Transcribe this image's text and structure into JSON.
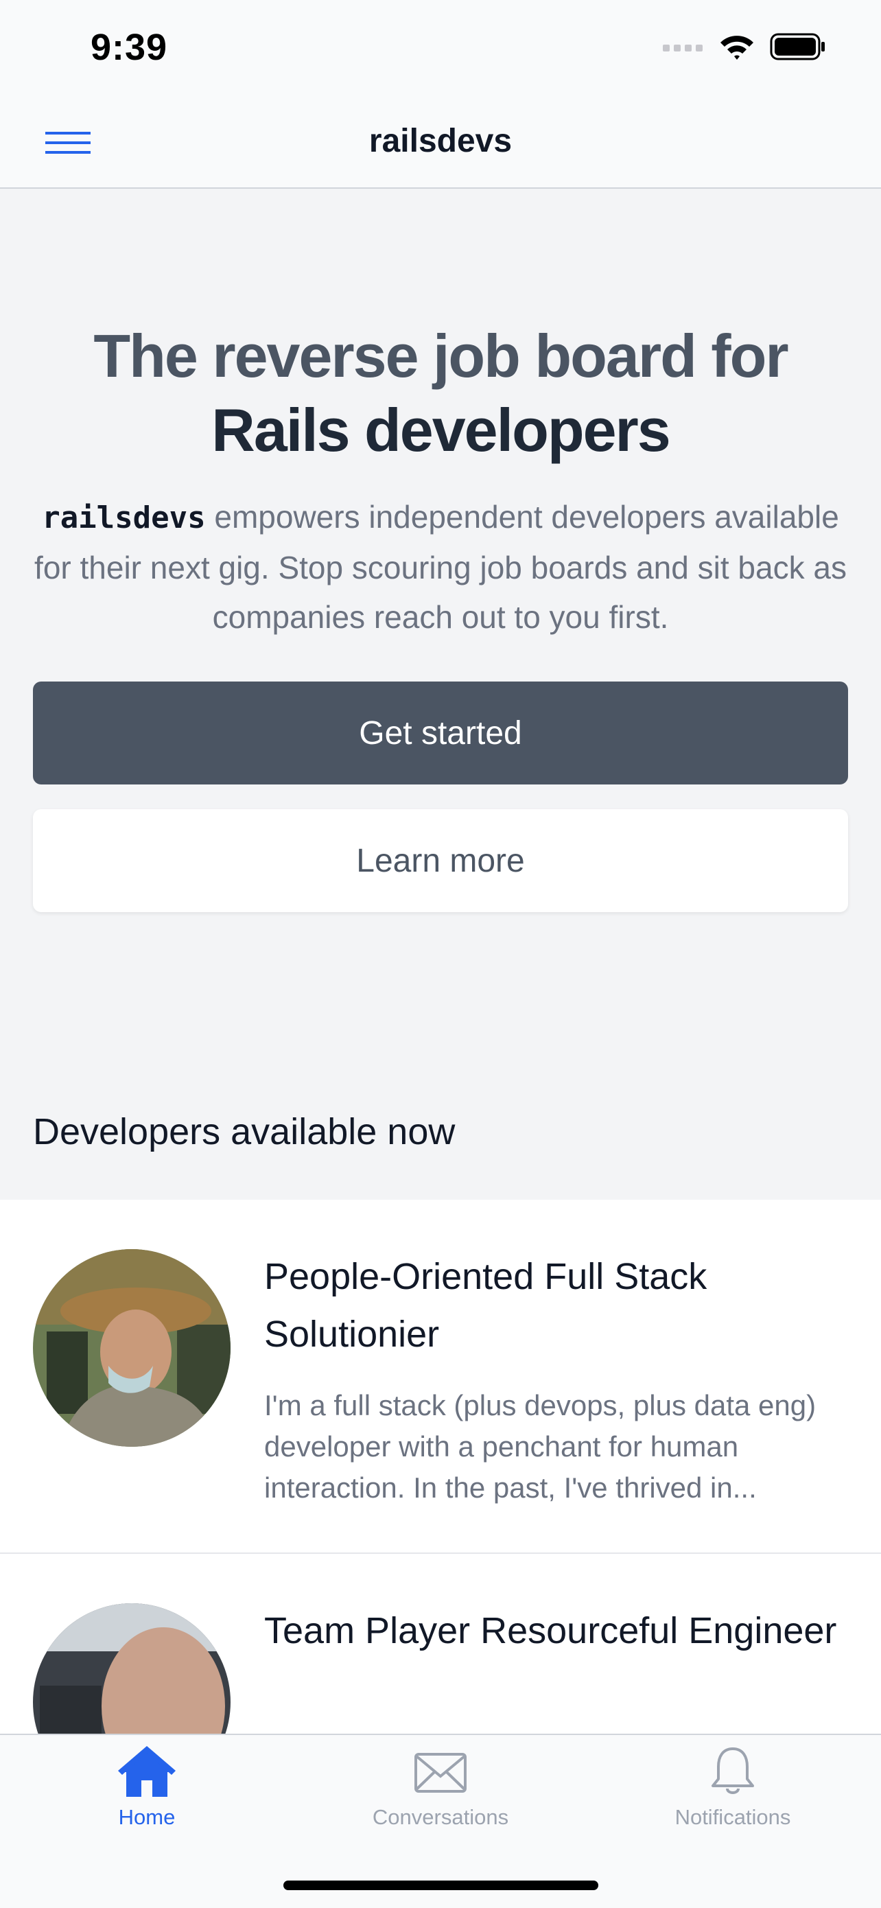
{
  "status_bar": {
    "time": "9:39"
  },
  "nav": {
    "title": "railsdevs",
    "menu_icon": "hamburger-menu-icon"
  },
  "hero": {
    "title_line1": "The reverse job board for",
    "title_line2": "Rails developers",
    "brand": "railsdevs",
    "description": " empowers independent developers available for their next gig. Stop scouring job boards and sit back as companies reach out to you first.",
    "primary_button": "Get started",
    "secondary_button": "Learn more"
  },
  "developers": {
    "heading": "Developers available now",
    "items": [
      {
        "title": "People-Oriented Full Stack Solutionier",
        "bio": "I'm a full stack (plus devops, plus data eng) developer with a penchant for human interaction. In the past, I've thrived in..."
      },
      {
        "title": "Team Player Resourceful Engineer",
        "bio": ""
      }
    ]
  },
  "tabs": [
    {
      "label": "Home",
      "icon": "home-icon",
      "active": true
    },
    {
      "label": "Conversations",
      "icon": "envelope-icon",
      "active": false
    },
    {
      "label": "Notifications",
      "icon": "bell-icon",
      "active": false
    }
  ],
  "colors": {
    "accent": "#2563eb",
    "primary_button": "#4b5563",
    "background": "#f3f4f6"
  }
}
